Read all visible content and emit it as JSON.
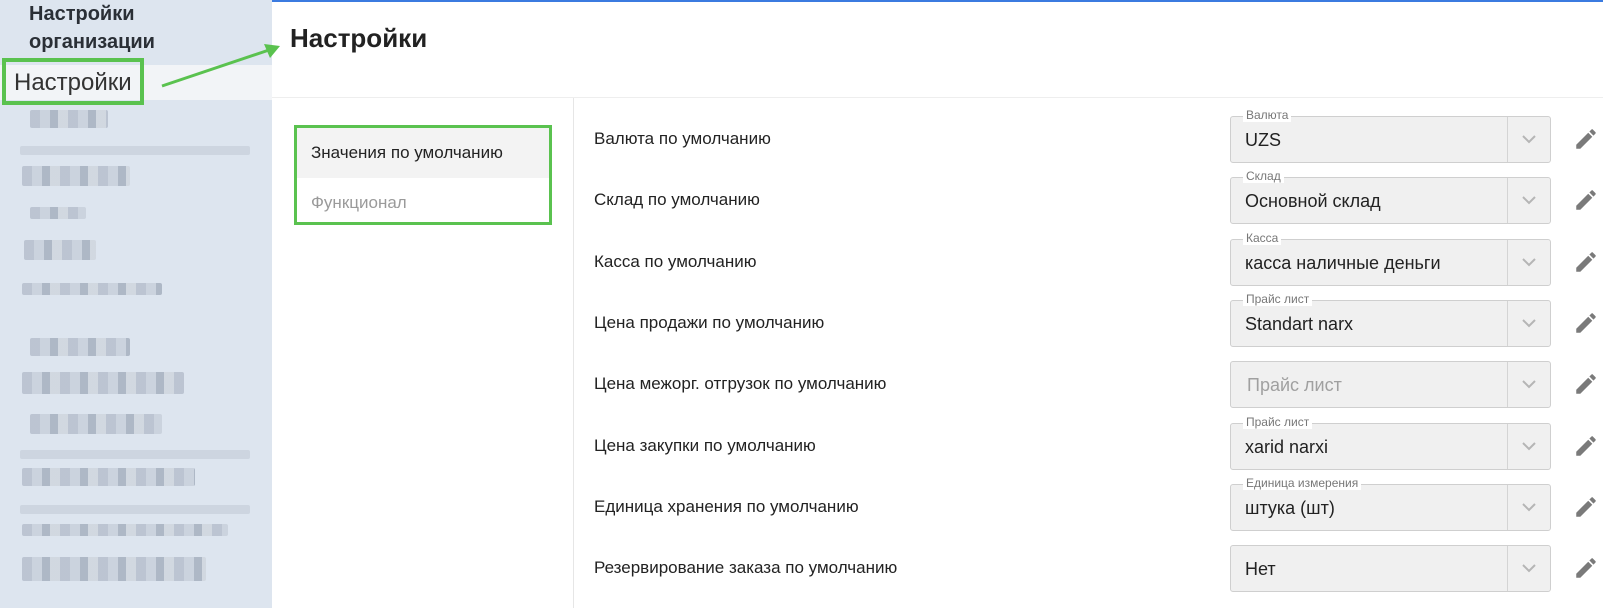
{
  "sidebar": {
    "org_title": "Настройки организации",
    "active_item": "Настройки"
  },
  "header": {
    "title": "Настройки"
  },
  "tabs": [
    {
      "label": "Значения по умолчанию",
      "active": true
    },
    {
      "label": "Функционал",
      "active": false
    }
  ],
  "settings": [
    {
      "label": "Валюта по умолчанию",
      "caption": "Валюта",
      "value": "UZS",
      "placeholder": false
    },
    {
      "label": "Склад по умолчанию",
      "caption": "Склад",
      "value": "Основной склад",
      "placeholder": false
    },
    {
      "label": "Касса по умолчанию",
      "caption": "Касса",
      "value": "касса наличные деньги",
      "placeholder": false
    },
    {
      "label": "Цена продажи по умолчанию",
      "caption": "Прайс лист",
      "value": "Standart narx",
      "placeholder": false
    },
    {
      "label": "Цена межорг. отгрузок по умолчанию",
      "caption": "",
      "value": "Прайс лист",
      "placeholder": true
    },
    {
      "label": "Цена закупки по умолчанию",
      "caption": "Прайс лист",
      "value": "xarid narxi",
      "placeholder": false
    },
    {
      "label": "Единица хранения по умолчанию",
      "caption": "Единица измерения",
      "value": "штука (шт)",
      "placeholder": false
    },
    {
      "label": "Резервирование заказа по умолчанию",
      "caption": "",
      "value": "Нет",
      "placeholder": false
    }
  ],
  "icons": {
    "dropdown": "chevron-down-icon",
    "edit": "pencil-icon",
    "annotation": "arrow-annotation"
  },
  "colors": {
    "highlight": "#5ac24f",
    "sidebar_bg": "#dde5ef",
    "accent_line": "#3b7be0"
  }
}
